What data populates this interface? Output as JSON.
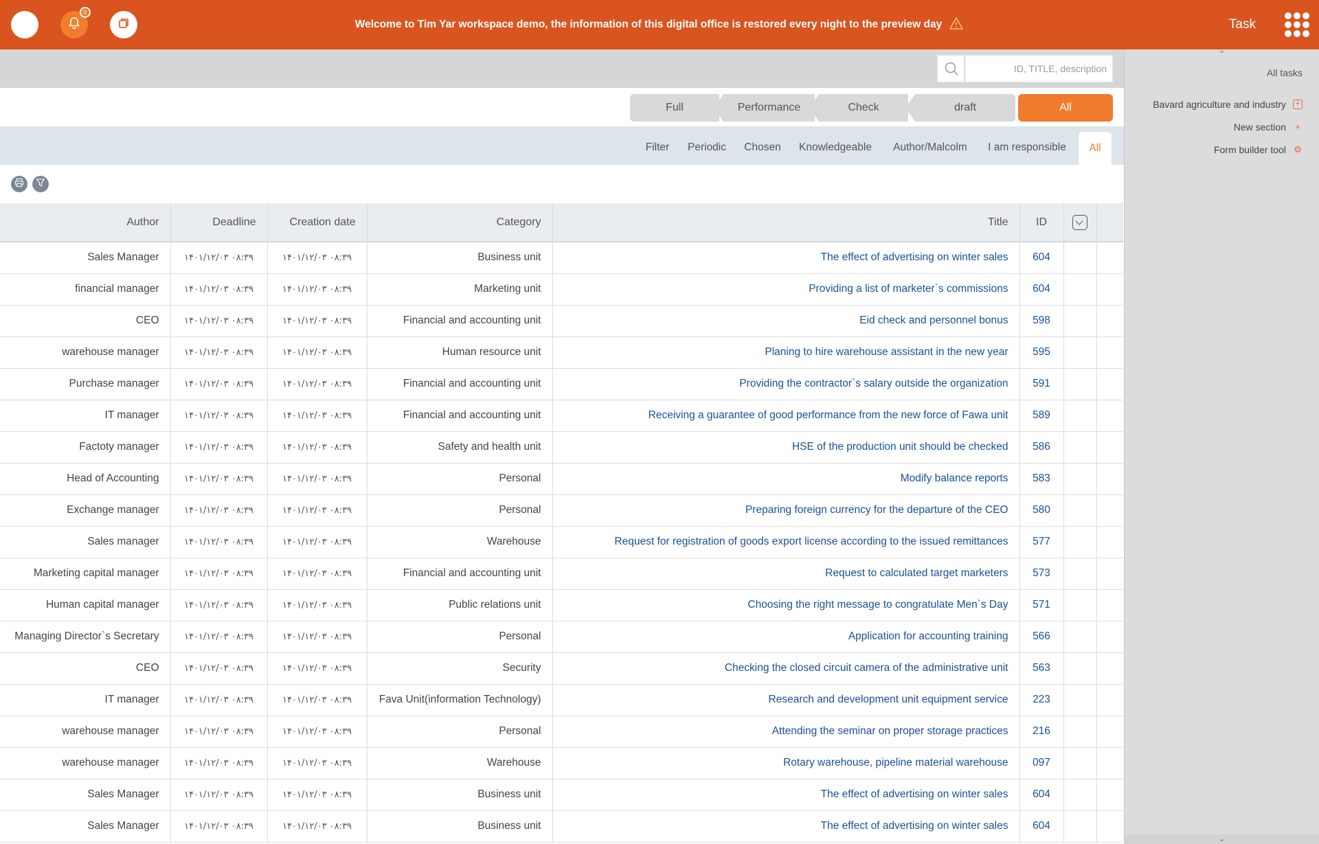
{
  "topbar": {
    "notice": "Welcome to Tim Yar workspace demo, the information of this digital office is restored every night to the preview day",
    "title": "Task",
    "notification_badge": "0",
    "accent_color": "#d9541e"
  },
  "search": {
    "placeholder": "ID, TITLE, description"
  },
  "statuses": [
    "Full",
    "Performance",
    "Check",
    "draft",
    "All"
  ],
  "active_status": "All",
  "tabs": [
    "Filter",
    "Periodic",
    "Chosen",
    "Knowledgeable",
    "Author/Malcolm",
    "I am responsible",
    "All"
  ],
  "active_tab": "All",
  "right_panel": {
    "all_tasks": "All tasks",
    "items": [
      {
        "label": "Bavard agriculture and industry",
        "icon": "plus-box-icon"
      },
      {
        "label": "New section",
        "icon": "plus-icon"
      },
      {
        "label": "Form builder tool",
        "icon": "gear-icon"
      }
    ]
  },
  "table": {
    "headers": {
      "author": "Author",
      "deadline": "Deadline",
      "creation": "Creation date",
      "category": "Category",
      "title": "Title",
      "id": "ID"
    },
    "date_value": "۱۴۰۱/۱۲/۰۳  ۰۸:۳۹",
    "rows": [
      {
        "author": "Sales Manager",
        "deadline": "۱۴۰۱/۱۲/۰۳  ۰۸:۳۹",
        "creation": "۱۴۰۱/۱۲/۰۳  ۰۸:۳۹",
        "category": "Business unit",
        "title": "The effect of advertising on winter sales",
        "id": "604"
      },
      {
        "author": "financial manager",
        "deadline": "۱۴۰۱/۱۲/۰۳  ۰۸:۳۹",
        "creation": "۱۴۰۱/۱۲/۰۳  ۰۸:۳۹",
        "category": "Marketing unit",
        "title": "Providing a list of marketer`s commissions",
        "id": "604"
      },
      {
        "author": "CEO",
        "deadline": "۱۴۰۱/۱۲/۰۳  ۰۸:۳۹",
        "creation": "۱۴۰۱/۱۲/۰۳  ۰۸:۳۹",
        "category": "Financial and accounting unit",
        "title": "Eid check and personnel bonus",
        "id": "598"
      },
      {
        "author": "warehouse manager",
        "deadline": "۱۴۰۱/۱۲/۰۳  ۰۸:۳۹",
        "creation": "۱۴۰۱/۱۲/۰۳  ۰۸:۳۹",
        "category": "Human resource unit",
        "title": "Planing to hire warehouse assistant in the new year",
        "id": "595"
      },
      {
        "author": "Purchase manager",
        "deadline": "۱۴۰۱/۱۲/۰۳  ۰۸:۳۹",
        "creation": "۱۴۰۱/۱۲/۰۳  ۰۸:۳۹",
        "category": "Financial and accounting unit",
        "title": "Providing the contractor`s salary outside the organization",
        "id": "591"
      },
      {
        "author": "IT manager",
        "deadline": "۱۴۰۱/۱۲/۰۳  ۰۸:۳۹",
        "creation": "۱۴۰۱/۱۲/۰۳  ۰۸:۳۹",
        "category": "Financial and accounting unit",
        "title": "Receiving a guarantee of good performance from the new force of Fawa unit",
        "id": "589"
      },
      {
        "author": "Factoty manager",
        "deadline": "۱۴۰۱/۱۲/۰۳  ۰۸:۳۹",
        "creation": "۱۴۰۱/۱۲/۰۳  ۰۸:۳۹",
        "category": "Safety and health unit",
        "title": "HSE of the production unit should be checked",
        "id": "586"
      },
      {
        "author": "Head of Accounting",
        "deadline": "۱۴۰۱/۱۲/۰۳  ۰۸:۳۹",
        "creation": "۱۴۰۱/۱۲/۰۳  ۰۸:۳۹",
        "category": "Personal",
        "title": "Modify balance reports",
        "id": "583"
      },
      {
        "author": "Exchange manager",
        "deadline": "۱۴۰۱/۱۲/۰۳  ۰۸:۳۹",
        "creation": "۱۴۰۱/۱۲/۰۳  ۰۸:۳۹",
        "category": "Personal",
        "title": "Preparing foreign currency for the departure of the CEO",
        "id": "580"
      },
      {
        "author": "Sales manager",
        "deadline": "۱۴۰۱/۱۲/۰۳  ۰۸:۳۹",
        "creation": "۱۴۰۱/۱۲/۰۳  ۰۸:۳۹",
        "category": "Warehouse",
        "title": "Request for registration of goods export license according to the issued remittances",
        "id": "577"
      },
      {
        "author": "Marketing capital manager",
        "deadline": "۱۴۰۱/۱۲/۰۳  ۰۸:۳۹",
        "creation": "۱۴۰۱/۱۲/۰۳  ۰۸:۳۹",
        "category": "Financial and accounting unit",
        "title": "Request to calculated target marketers",
        "id": "573"
      },
      {
        "author": "Human capital manager",
        "deadline": "۱۴۰۱/۱۲/۰۳  ۰۸:۳۹",
        "creation": "۱۴۰۱/۱۲/۰۳  ۰۸:۳۹",
        "category": "Public relations unit",
        "title": "Choosing the right message to congratulate Men`s Day",
        "id": "571"
      },
      {
        "author": "Managing Director`s Secretary",
        "deadline": "۱۴۰۱/۱۲/۰۳  ۰۸:۳۹",
        "creation": "۱۴۰۱/۱۲/۰۳  ۰۸:۳۹",
        "category": "Personal",
        "title": "Application for accounting training",
        "id": "566"
      },
      {
        "author": "CEO",
        "deadline": "۱۴۰۱/۱۲/۰۳  ۰۸:۳۹",
        "creation": "۱۴۰۱/۱۲/۰۳  ۰۸:۳۹",
        "category": "Security",
        "title": "Checking the closed circuit camera of the administrative unit",
        "id": "563"
      },
      {
        "author": "IT manager",
        "deadline": "۱۴۰۱/۱۲/۰۳  ۰۸:۳۹",
        "creation": "۱۴۰۱/۱۲/۰۳  ۰۸:۳۹",
        "category": "Fava Unit(information Technology)",
        "title": "Research and development unit equipment service",
        "id": "223"
      },
      {
        "author": "warehouse manager",
        "deadline": "۱۴۰۱/۱۲/۰۳  ۰۸:۳۹",
        "creation": "۱۴۰۱/۱۲/۰۳  ۰۸:۳۹",
        "category": "Personal",
        "title": "Attending the seminar on proper storage practices",
        "id": "216"
      },
      {
        "author": "warehouse manager",
        "deadline": "۱۴۰۱/۱۲/۰۳  ۰۸:۳۹",
        "creation": "۱۴۰۱/۱۲/۰۳  ۰۸:۳۹",
        "category": "Warehouse",
        "title": "Rotary warehouse, pipeline material warehouse",
        "id": "097"
      },
      {
        "author": "Sales Manager",
        "deadline": "۱۴۰۱/۱۲/۰۳  ۰۸:۳۹",
        "creation": "۱۴۰۱/۱۲/۰۳  ۰۸:۳۹",
        "category": "Business unit",
        "title": "The effect of advertising on winter sales",
        "id": "604"
      },
      {
        "author": "Sales Manager",
        "deadline": "۱۴۰۱/۱۲/۰۳  ۰۸:۳۹",
        "creation": "۱۴۰۱/۱۲/۰۳  ۰۸:۳۹",
        "category": "Business unit",
        "title": "The effect of advertising on winter sales",
        "id": "604"
      }
    ]
  }
}
